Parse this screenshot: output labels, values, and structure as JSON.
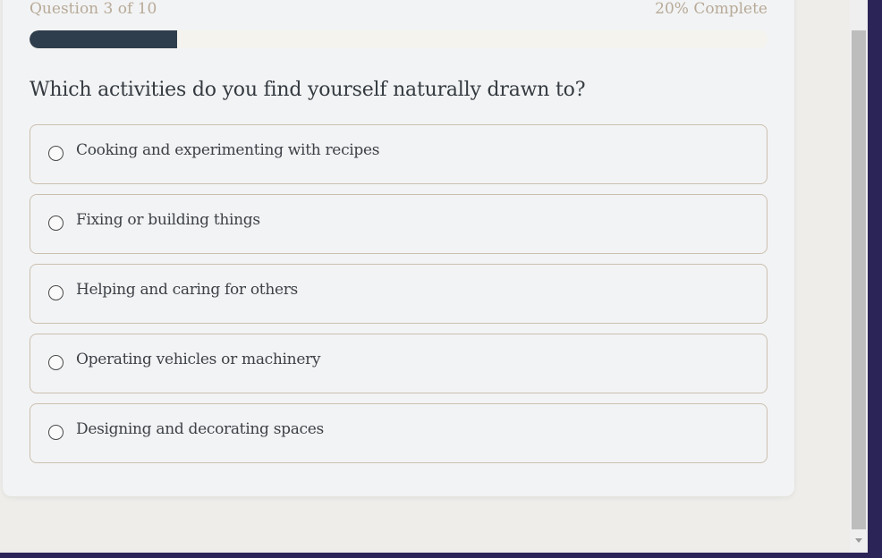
{
  "quiz": {
    "progress_label": "Question 3 of 10",
    "completion_label": "20% Complete",
    "progress_fraction": 0.2,
    "question": "Which activities do you find yourself naturally drawn to?",
    "options": [
      {
        "label": "Cooking and experimenting with recipes"
      },
      {
        "label": "Fixing or building things"
      },
      {
        "label": "Helping and caring for others"
      },
      {
        "label": "Operating vehicles or machinery"
      },
      {
        "label": "Designing and decorating spaces"
      }
    ]
  },
  "colors": {
    "progress_fill": "#2f3e4c",
    "meta_text": "#b7aa98",
    "option_border": "#cbbfb0"
  }
}
